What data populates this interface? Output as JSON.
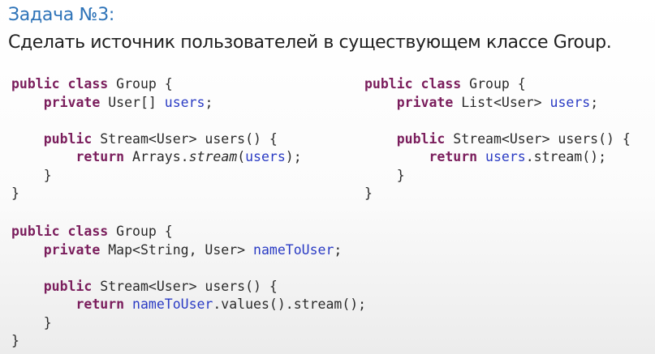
{
  "slide": {
    "title": "Задача №3:",
    "subtitle": "Сделать источник пользователей в существующем классе Group."
  },
  "code_blocks": [
    {
      "id": "array-version",
      "lines": [
        [
          {
            "t": "public class",
            "s": "kw"
          },
          {
            "t": " Group {",
            "s": "pl"
          }
        ],
        [
          {
            "t": "    ",
            "s": "pl"
          },
          {
            "t": "private",
            "s": "kw"
          },
          {
            "t": " User[] ",
            "s": "pl"
          },
          {
            "t": "users",
            "s": "fld"
          },
          {
            "t": ";",
            "s": "pl"
          }
        ],
        [],
        [
          {
            "t": "    ",
            "s": "pl"
          },
          {
            "t": "public",
            "s": "kw"
          },
          {
            "t": " Stream<User> users() {",
            "s": "pl"
          }
        ],
        [
          {
            "t": "        ",
            "s": "pl"
          },
          {
            "t": "return",
            "s": "kw"
          },
          {
            "t": " Arrays.",
            "s": "pl"
          },
          {
            "t": "stream",
            "s": "it"
          },
          {
            "t": "(",
            "s": "pl"
          },
          {
            "t": "users",
            "s": "fld"
          },
          {
            "t": ");",
            "s": "pl"
          }
        ],
        [
          {
            "t": "    }",
            "s": "pl"
          }
        ],
        [
          {
            "t": "}",
            "s": "pl"
          }
        ]
      ]
    },
    {
      "id": "list-version",
      "lines": [
        [
          {
            "t": "public class",
            "s": "kw"
          },
          {
            "t": " Group {",
            "s": "pl"
          }
        ],
        [
          {
            "t": "    ",
            "s": "pl"
          },
          {
            "t": "private",
            "s": "kw"
          },
          {
            "t": " List<User> ",
            "s": "pl"
          },
          {
            "t": "users",
            "s": "fld"
          },
          {
            "t": ";",
            "s": "pl"
          }
        ],
        [],
        [
          {
            "t": "    ",
            "s": "pl"
          },
          {
            "t": "public",
            "s": "kw"
          },
          {
            "t": " Stream<User> users() {",
            "s": "pl"
          }
        ],
        [
          {
            "t": "        ",
            "s": "pl"
          },
          {
            "t": "return",
            "s": "kw"
          },
          {
            "t": " ",
            "s": "pl"
          },
          {
            "t": "users",
            "s": "fld"
          },
          {
            "t": ".stream();",
            "s": "pl"
          }
        ],
        [
          {
            "t": "    }",
            "s": "pl"
          }
        ],
        [
          {
            "t": "}",
            "s": "pl"
          }
        ]
      ]
    },
    {
      "id": "map-version",
      "lines": [
        [
          {
            "t": "public class",
            "s": "kw"
          },
          {
            "t": " Group {",
            "s": "pl"
          }
        ],
        [
          {
            "t": "    ",
            "s": "pl"
          },
          {
            "t": "private",
            "s": "kw"
          },
          {
            "t": " Map<String, User> ",
            "s": "pl"
          },
          {
            "t": "nameToUser",
            "s": "fld"
          },
          {
            "t": ";",
            "s": "pl"
          }
        ],
        [],
        [
          {
            "t": "    ",
            "s": "pl"
          },
          {
            "t": "public",
            "s": "kw"
          },
          {
            "t": " Stream<User> users() {",
            "s": "pl"
          }
        ],
        [
          {
            "t": "        ",
            "s": "pl"
          },
          {
            "t": "return",
            "s": "kw"
          },
          {
            "t": " ",
            "s": "pl"
          },
          {
            "t": "nameToUser",
            "s": "fld"
          },
          {
            "t": ".values().stream();",
            "s": "pl"
          }
        ],
        [
          {
            "t": "    }",
            "s": "pl"
          }
        ],
        [
          {
            "t": "}",
            "s": "pl"
          }
        ]
      ]
    }
  ],
  "colors": {
    "title": "#2e73b8",
    "keyword": "#7a1d5c",
    "field": "#2a3bc4",
    "text": "#2a2a2a"
  }
}
